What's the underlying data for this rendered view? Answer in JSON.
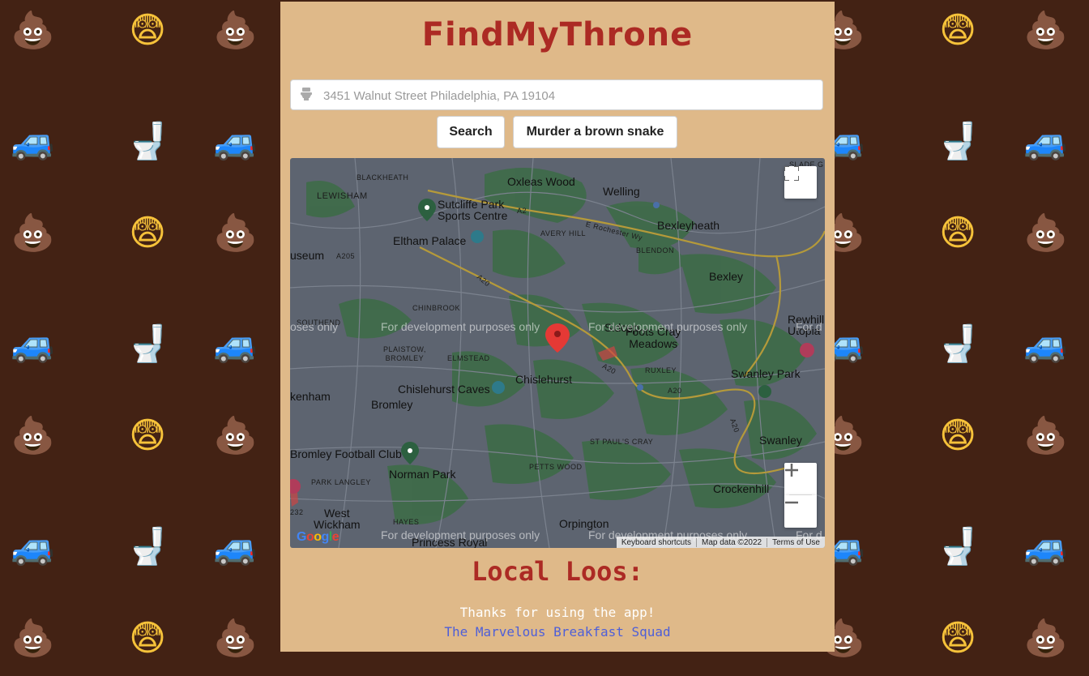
{
  "app": {
    "title": "FindMyThrone"
  },
  "search": {
    "placeholder": "3451 Walnut Street Philadelphia, PA 19104",
    "value": ""
  },
  "buttons": {
    "search_label": "Search",
    "murder_label": "Murder a brown snake"
  },
  "map": {
    "watermark": "For development purposes only",
    "watermark_left_fragment": "oses only",
    "watermark_right_fragment": "For d",
    "places": {
      "blackheath": "BLACKHEATH",
      "oxleas_wood": "Oxleas Wood",
      "welling": "Welling",
      "slade_green": "SLADE G",
      "lewisham": "LEWISHAM",
      "sutcliffe_park": "Sutcliffe Park\nSports Centre",
      "a2": "A2",
      "e_rochester_wy": "E Rochester Wy",
      "bexleyheath": "Bexleyheath",
      "avery_hill": "AVERY HILL",
      "eltham_palace": "Eltham Palace",
      "blendon": "BLENDON",
      "museum": "useum",
      "a205": "A205",
      "a20": "A20",
      "bexley": "Bexley",
      "chinbrook": "CHINBROOK",
      "southend": "SOUTHEND",
      "sidcup": "Sidcup",
      "foots_cray_meadows": "Foots Cray\nMeadows",
      "rewhill": "Rewhill\nUtopia",
      "plaistow": "PLAISTOW,\nBROMLEY",
      "elmstead": "ELMSTEAD",
      "chislehurst": "Chislehurst",
      "ruxley": "RUXLEY",
      "swanley_park": "Swanley Park",
      "chislehurst_caves": "Chislehurst Caves",
      "kenham": "kenham",
      "bromley": "Bromley",
      "swanley": "Swanley",
      "st_pauls_cray": "ST PAUL'S CRAY",
      "bromley_fc": "Bromley Football Club",
      "norman_park": "Norman Park",
      "petts_wood": "PETTS WOOD",
      "park_langley": "PARK LANGLEY",
      "crockenhill": "Crockenhill",
      "west_wickham": "West\nWickham",
      "hayes": "HAYES",
      "orpington": "Orpington",
      "princess_royal": "Princess Royal",
      "num_232": "232",
      "num_25": "25"
    },
    "attribution": {
      "shortcuts": "Keyboard shortcuts",
      "map_data": "Map data ©2022",
      "terms": "Terms of Use"
    },
    "google_logo": "Google"
  },
  "loos": {
    "title": "Local Loos:"
  },
  "footer": {
    "thanks": "Thanks for using the app!",
    "squad": "The Marvelous Breakfast Squad"
  },
  "colors": {
    "background": "#432214",
    "panel": "#dfb989",
    "accent": "#ac2a24",
    "link": "#4e5fd8"
  },
  "background_icons": [
    "poop-emoji",
    "scared-face-emoji",
    "car-emoji",
    "toilet-emoji"
  ]
}
